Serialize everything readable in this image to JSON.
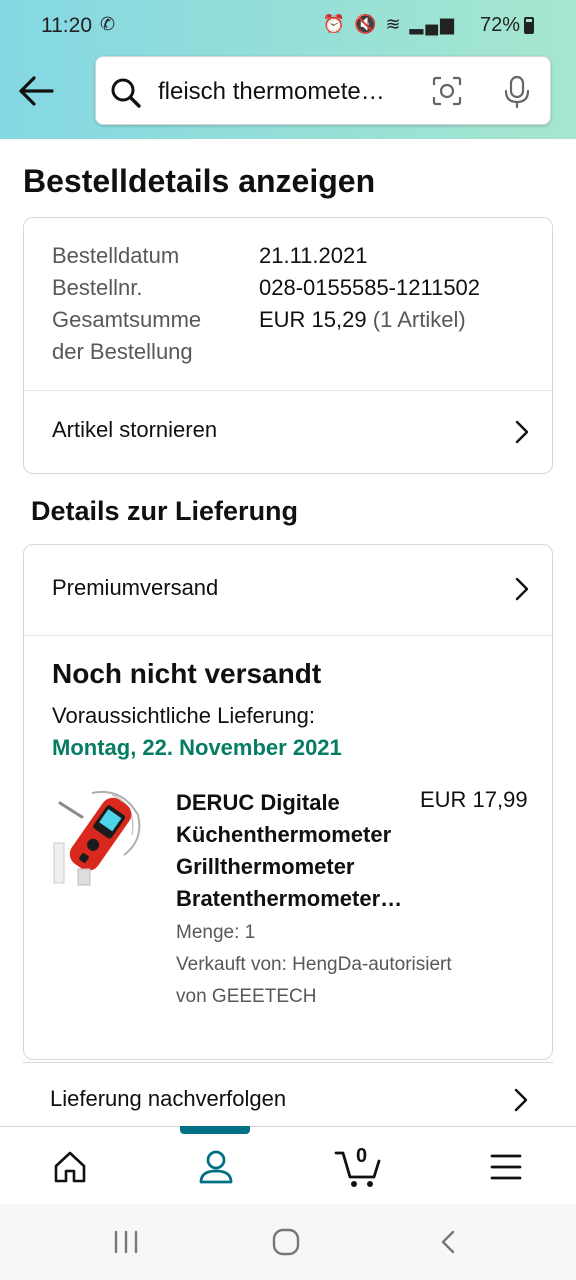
{
  "status_bar": {
    "time": "11:20",
    "battery": "72%"
  },
  "search": {
    "query": "fleisch thermomete…"
  },
  "page": {
    "title": "Bestelldetails anzeigen"
  },
  "order_summary": {
    "date_label": "Bestelldatum",
    "date_value": "21.11.2021",
    "order_no_label": "Bestellnr.",
    "order_no_value": "028-0155585-1211502",
    "total_label_line1": "Gesamtsumme",
    "total_label_line2": "der Bestellung",
    "total_value": "EUR 15,29",
    "total_items": "(1 Artikel)",
    "cancel_label": "Artikel stornieren"
  },
  "delivery": {
    "section_title": "Details zur Lieferung",
    "shipping_method": "Premiumversand",
    "status": "Noch nicht versandt",
    "expected_label": "Voraussichtliche Lieferung:",
    "expected_date": "Montag, 22. November 2021",
    "track_label": "Lieferung nachverfolgen"
  },
  "product": {
    "title_lines": [
      "DERUC Digitale",
      "Küchenthermometer",
      "Grillthermometer",
      "Bratenthermometer…"
    ],
    "price": "EUR 17,99",
    "quantity": "Menge: 1",
    "seller_line1": "Verkauft von: HengDa-autorisiert",
    "seller_line2": "von GEEETECH"
  },
  "bottom_nav": {
    "cart_count": "0"
  },
  "colors": {
    "accent": "#007185",
    "delivery_green": "#067d62",
    "header_start": "#84d8e3",
    "header_end": "#a6e6ce"
  }
}
